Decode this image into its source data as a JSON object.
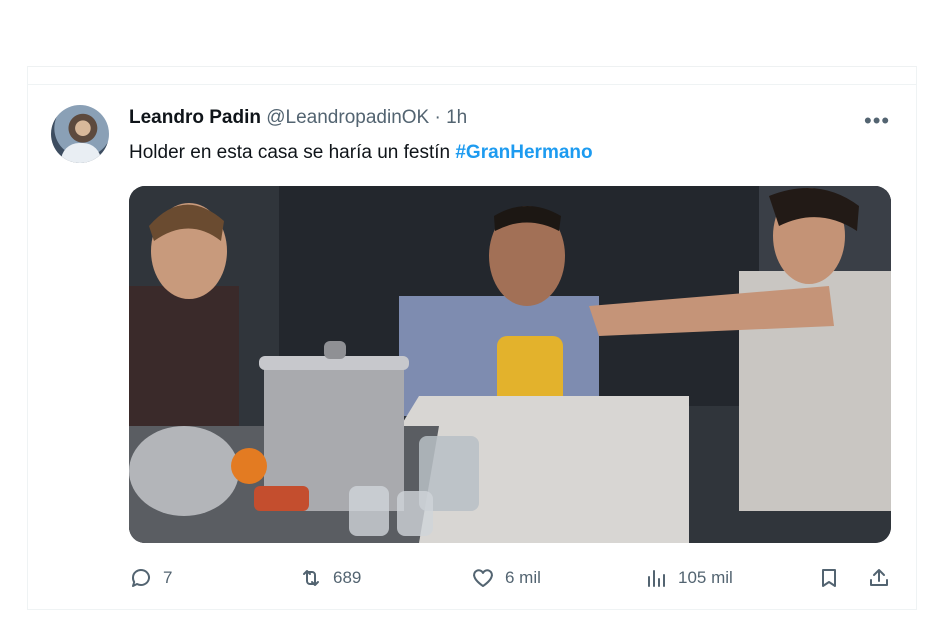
{
  "tweet": {
    "display_name": "Leandro Padin",
    "handle": "@LeandropadinOK",
    "separator": "·",
    "time": "1h",
    "text_before": "Holder en esta casa se haría un festín ",
    "hashtag": "#GranHermano"
  },
  "actions": {
    "replies": "7",
    "retweets": "689",
    "likes": "6 mil",
    "views": "105 mil"
  },
  "icons": {
    "more": "more-horizontal-icon",
    "reply": "reply-icon",
    "retweet": "retweet-icon",
    "like": "heart-icon",
    "views": "views-chart-icon",
    "bookmark": "bookmark-icon",
    "share": "share-icon"
  },
  "colors": {
    "link": "#1d9bf0",
    "muted": "#536471",
    "text": "#0f1419"
  }
}
